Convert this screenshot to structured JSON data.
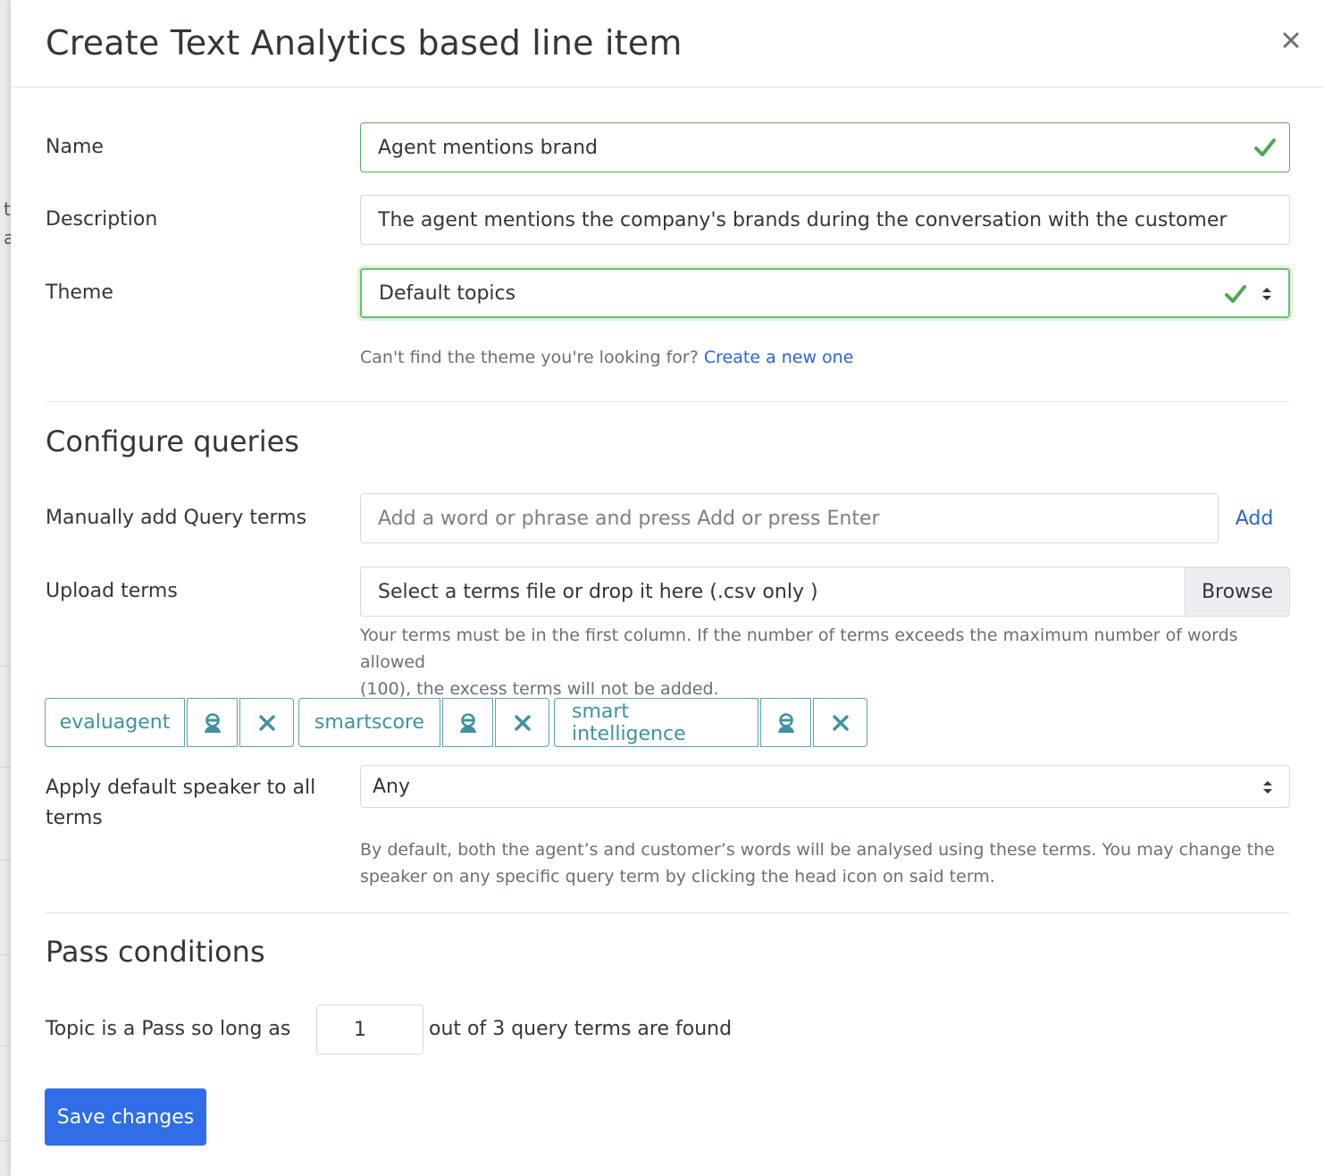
{
  "backdrop": {
    "fragment_1": "t",
    "fragment_2": "a"
  },
  "modal": {
    "title": "Create Text Analytics based line item",
    "close_icon": "close-icon"
  },
  "form": {
    "name": {
      "label": "Name",
      "value": "Agent mentions brand",
      "status": "valid"
    },
    "description": {
      "label": "Description",
      "value": "The agent mentions the company's brands during the conversation with the customer"
    },
    "theme": {
      "label": "Theme",
      "selected": "Default topics",
      "help_prefix": "Can't find the theme you're looking for?",
      "help_link": "Create a new one"
    }
  },
  "configure_queries": {
    "title": "Configure queries",
    "manual_terms": {
      "label": "Manually add Query terms",
      "placeholder": "Add a word or phrase and press Add or press Enter",
      "add_label": "Add"
    },
    "upload": {
      "label": "Upload terms",
      "placeholder": "Select a terms file or drop it here (.csv only )",
      "browse_label": "Browse",
      "help_line_1": "Your terms must be in the first column. If the number of terms exceeds the maximum number of words allowed",
      "help_line_2": "(100), the excess terms will not be added."
    },
    "terms": [
      {
        "text": "evaluagent"
      },
      {
        "text": "smartscore"
      },
      {
        "text": "smart intelligence"
      }
    ],
    "speaker": {
      "label_line_1": "Apply default speaker to all",
      "label_line_2": "terms",
      "selected": "Any",
      "help_line_1": "By default, both the agent’s and customer’s words will be analysed using these terms. You may change the",
      "help_line_2": "speaker on any specific query term by clicking the head icon on said term."
    }
  },
  "pass_conditions": {
    "title": "Pass conditions",
    "prefix": "Topic is a Pass so long as",
    "count": "1",
    "suffix": "out of 3 query terms are found"
  },
  "actions": {
    "save_label": "Save changes"
  },
  "colors": {
    "valid": "#5cae5c",
    "link": "#2966d6",
    "tag": "#3e93a1",
    "primary": "#2f6ee6"
  }
}
